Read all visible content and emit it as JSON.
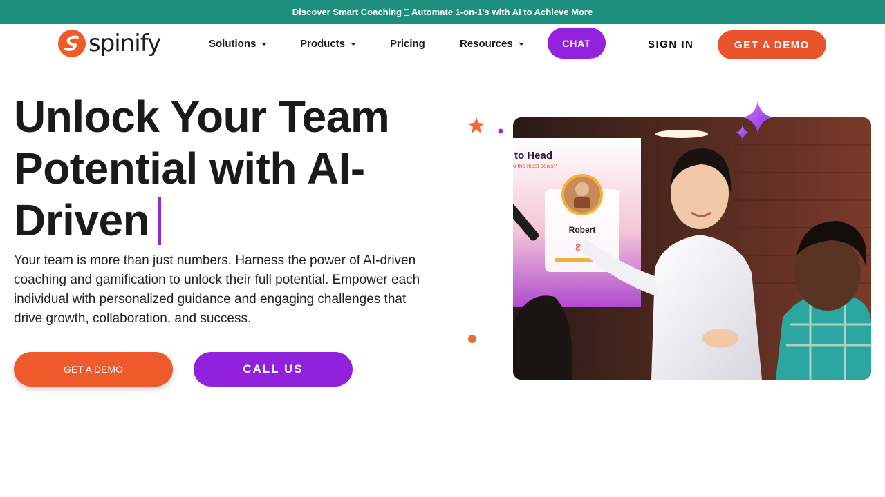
{
  "announcement": {
    "left_text": "Discover Smart Coaching",
    "right_text": "Automate 1-on-1's with AI to Achieve More"
  },
  "brand": {
    "name": "spinify",
    "accent": "#f05a28",
    "purple": "#9321dd",
    "teal": "#1d8f7e"
  },
  "nav": {
    "solutions": "Solutions",
    "products": "Products",
    "pricing": "Pricing",
    "resources": "Resources",
    "chat": "CHAT",
    "sign_in": "SIGN IN",
    "get_demo": "GET A DEMO"
  },
  "hero": {
    "title_line1": "Unlock Your Team",
    "title_line2": "Potential with AI-",
    "title_line3": "Driven",
    "description": "Your team is more than just numbers. Harness the power of AI-driven coaching and gamification to unlock their full potential. Empower each individual with personalized guidance and engaging challenges that drive growth, collaboration, and success.",
    "cta_demo": "GET A DEMO",
    "cta_call": "CALL US"
  },
  "photo": {
    "screen_heading": "to Head",
    "screen_subheading": "o the most deals?",
    "card_name": "Robert",
    "card_value": "89"
  },
  "icons": {
    "star": "star-icon",
    "sparkle": "sparkle-icon",
    "dot": "dot-icon",
    "caret": "chevron-down-icon"
  }
}
